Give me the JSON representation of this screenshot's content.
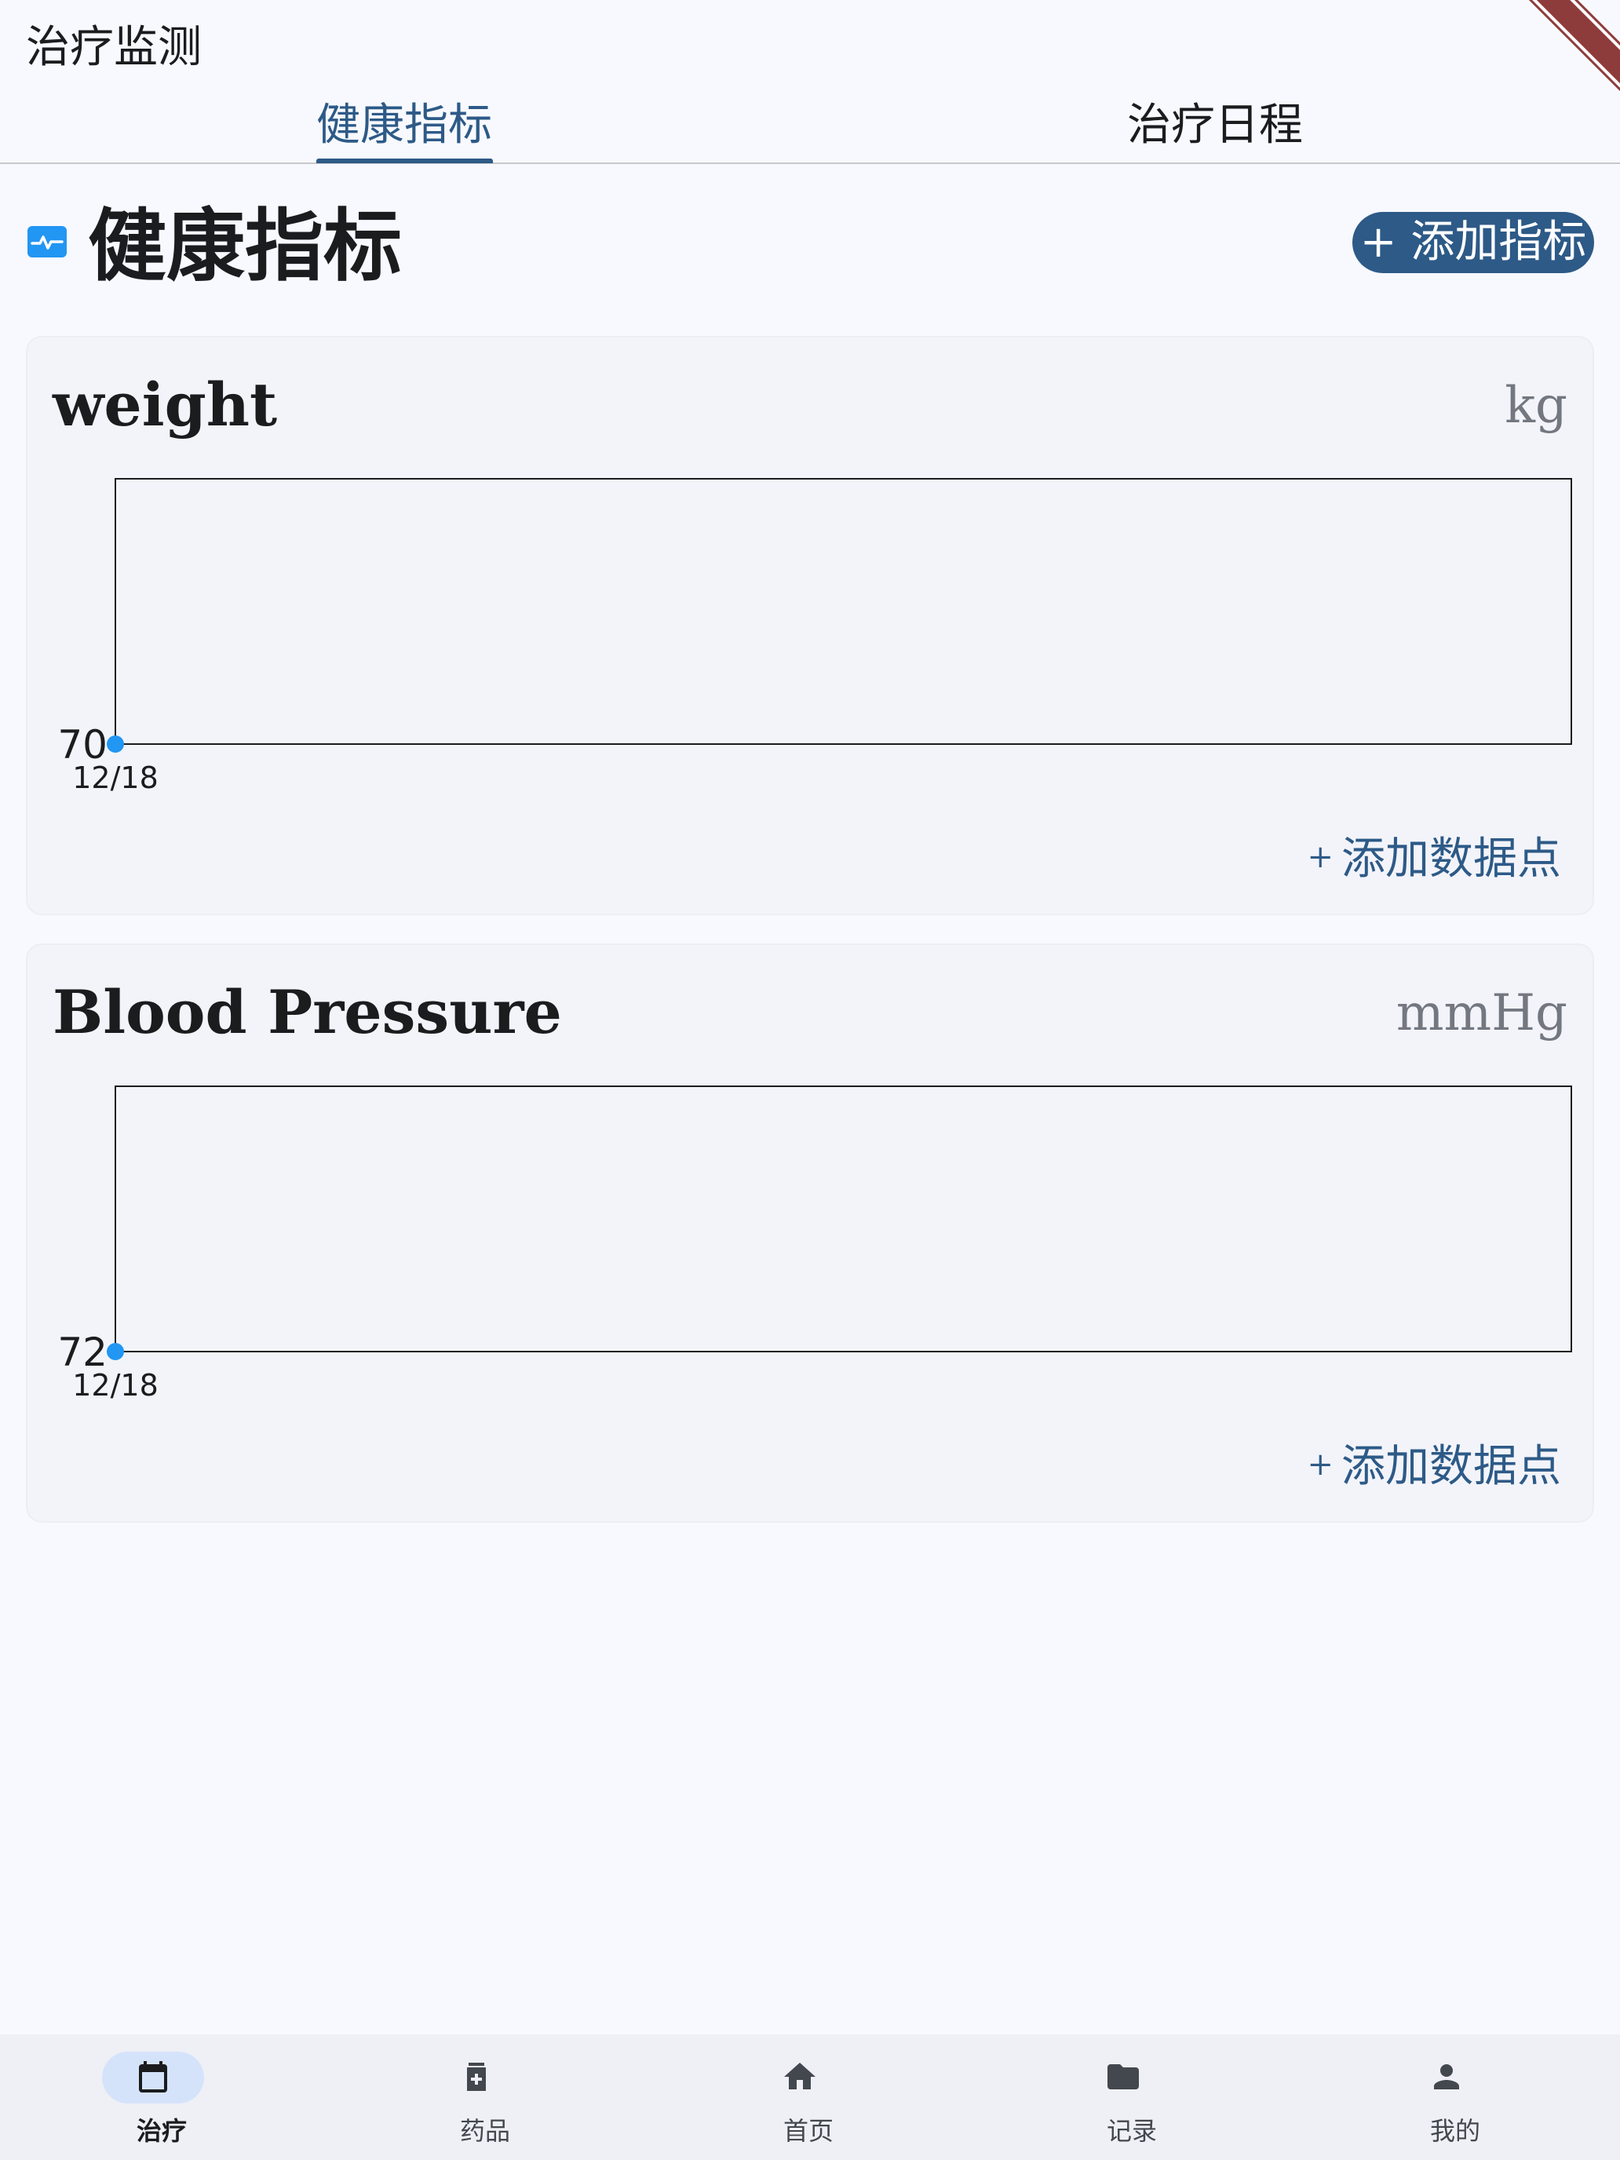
{
  "app_title": "治疗监测",
  "tabs": [
    {
      "label": "健康指标",
      "active": true
    },
    {
      "label": "治疗日程",
      "active": false
    }
  ],
  "section": {
    "icon": "monitor-heart-icon",
    "title": "健康指标",
    "add_button": "+ 添加指标"
  },
  "metrics": [
    {
      "name": "weight",
      "unit": "kg",
      "add_point_label": "添加数据点",
      "chart_data": {
        "type": "line",
        "x": [
          "12/18"
        ],
        "values": [
          70
        ],
        "y_tick_labels": [
          "70"
        ],
        "x_tick_labels": [
          "12/18"
        ],
        "point_color": "#2196f3"
      }
    },
    {
      "name": "Blood Pressure",
      "unit": "mmHg",
      "add_point_label": "添加数据点",
      "chart_data": {
        "type": "line",
        "x": [
          "12/18"
        ],
        "values": [
          72
        ],
        "y_tick_labels": [
          "72"
        ],
        "x_tick_labels": [
          "12/18"
        ],
        "point_color": "#2196f3"
      }
    }
  ],
  "bottom_nav": [
    {
      "label": "治疗",
      "icon": "calendar-icon",
      "active": true
    },
    {
      "label": "药品",
      "icon": "medication-icon",
      "active": false
    },
    {
      "label": "首页",
      "icon": "home-icon",
      "active": false
    },
    {
      "label": "记录",
      "icon": "folder-icon",
      "active": false
    },
    {
      "label": "我的",
      "icon": "person-icon",
      "active": false
    }
  ],
  "colors": {
    "primary": "#2d5a87",
    "accent": "#2196f3",
    "background": "#f8f9fe",
    "card": "#f3f4fa"
  }
}
